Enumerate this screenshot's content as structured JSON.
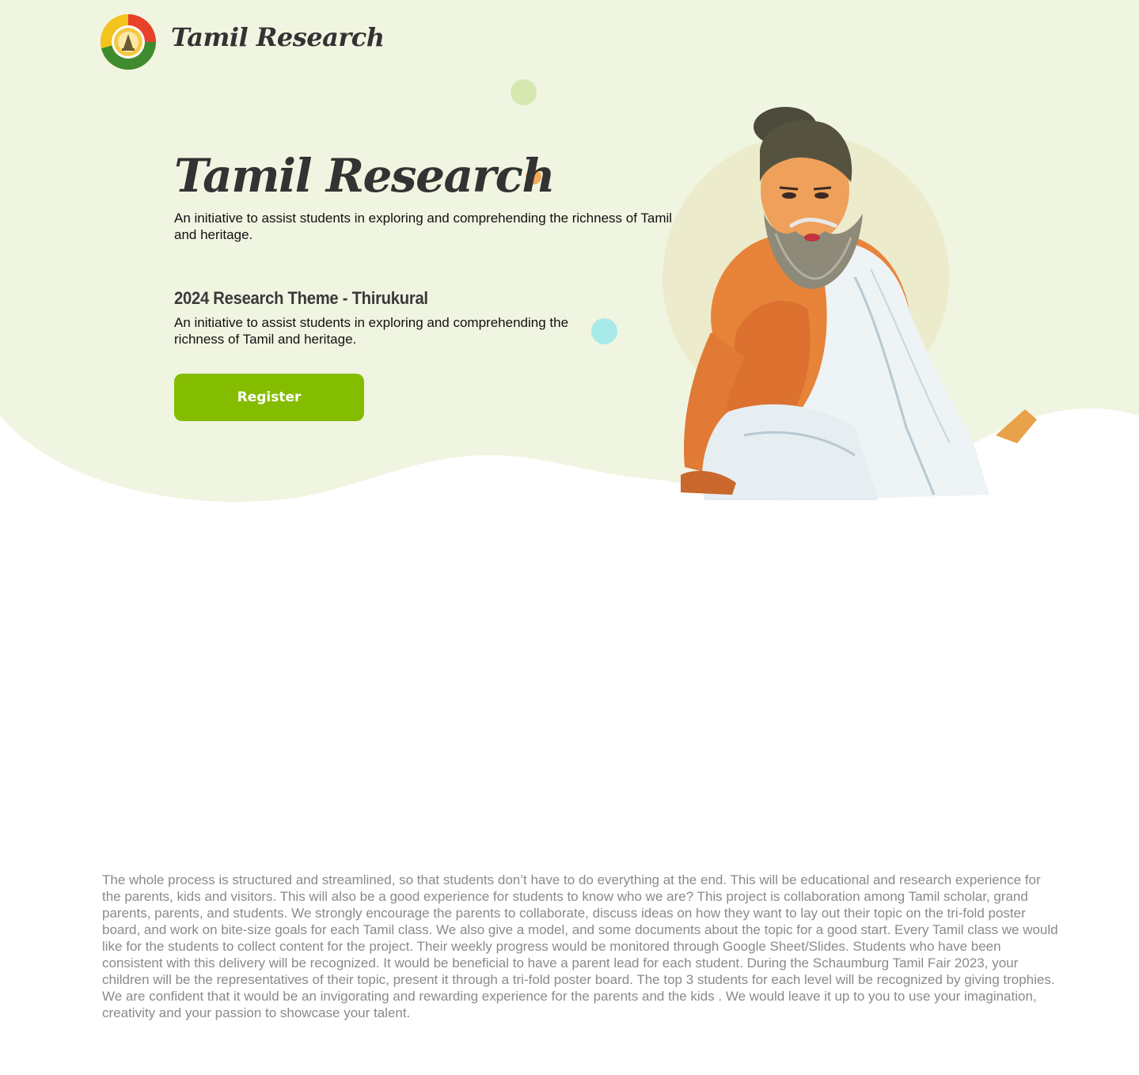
{
  "header": {
    "brand": "Tamil Research",
    "logo_icon": "tamil-research-emblem"
  },
  "hero": {
    "title": "Tamil Research",
    "subtitle": "An initiative to assist students in exploring and comprehending the richness of Tamil and heritage.",
    "theme_title": "2024 Research Theme - Thirukural",
    "theme_description": "An initiative to assist students in exploring and comprehending the richness of Tamil and heritage.",
    "register_label": "Register",
    "illustration": "thiruvalluvar-portrait"
  },
  "about": {
    "text": "The whole process is structured and streamlined, so that students don’t have to do everything at the end. This will be educational and research experience for the parents, kids and visitors. This will also be a good experience for students to know who we are? This project is collaboration among Tamil scholar, grand parents, parents, and students. We strongly encourage the parents to collaborate, discuss ideas on how they want to lay out their topic on the tri-fold poster board, and work on bite-size goals for each Tamil class. We also give a model, and some documents about the topic for a good start. Every Tamil class we would like for the students to collect content for the project. Their weekly progress would be monitored through Google Sheet/Slides. Students who have been consistent with this delivery will be recognized. It would be beneficial to have a parent lead for each student. During the Schaumburg Tamil Fair 2023, your children will be the representatives of their topic, present it through a tri-fold poster board. The top 3 students for each level will be recognized by giving trophies. We are confident that it would be an invigorating and rewarding experience for the parents and the kids . We would leave it up to you to use your imagination, creativity and your passion to showcase your talent."
  },
  "colors": {
    "hero_background": "#f0f5e1",
    "accent_green": "#84bd00",
    "dot_green": "#d6e8b0",
    "dot_orange": "#f7a858",
    "dot_cyan": "#a8eaea",
    "title_text": "#333333",
    "body_muted": "#8a8a8a"
  }
}
